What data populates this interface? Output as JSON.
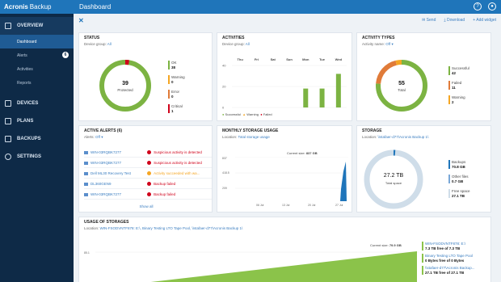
{
  "app": {
    "brand": "Acronis",
    "brand_sub": "Backup",
    "page_title": "Dashboard"
  },
  "sidebar": {
    "sections": [
      {
        "label": "OVERVIEW"
      },
      {
        "label": "DEVICES"
      },
      {
        "label": "PLANS"
      },
      {
        "label": "BACKUPS"
      },
      {
        "label": "SETTINGS"
      }
    ],
    "overview_items": [
      {
        "label": "Dashboard"
      },
      {
        "label": "Alerts",
        "badge": "6"
      },
      {
        "label": "Activities"
      },
      {
        "label": "Reports"
      }
    ]
  },
  "toolbar": {
    "send": "Send",
    "download": "Download",
    "add_widget": "+ Add widget"
  },
  "status": {
    "title": "STATUS",
    "filter_label": "Device group:",
    "filter_value": "All",
    "center_value": "39",
    "center_label": "Protected",
    "legend": [
      {
        "label": "OK",
        "value": "38",
        "color": "#7cb342"
      },
      {
        "label": "Warning",
        "value": "0",
        "color": "#f5a623"
      },
      {
        "label": "Error",
        "value": "0",
        "color": "#e07b39"
      },
      {
        "label": "Critical",
        "value": "1",
        "color": "#d0021b"
      }
    ]
  },
  "activities": {
    "title": "ACTIVITIES",
    "filter_label": "Device group:",
    "filter_value": "All",
    "legend": {
      "success": "Successful",
      "warning": "Warning",
      "failed": "Failed"
    },
    "chart_data": {
      "type": "bar",
      "categories": [
        "Thu",
        "Fri",
        "Sat",
        "Sun",
        "Mon",
        "Tue",
        "Wed"
      ],
      "ylim": [
        0,
        40
      ],
      "yticks": [
        "40",
        "20",
        "0"
      ],
      "series": [
        {
          "name": "Successful",
          "values": [
            0,
            0,
            0,
            0,
            18,
            18,
            32
          ]
        },
        {
          "name": "Failed",
          "values": [
            0,
            0,
            0,
            0,
            0,
            0,
            0
          ]
        }
      ]
    }
  },
  "activity_types": {
    "title": "ACTIVITY TYPES",
    "filter_label": "Activity name:",
    "filter_value": "Off",
    "center_value": "55",
    "center_label": "Total",
    "legend": [
      {
        "label": "Successful",
        "value": "42",
        "color": "#7cb342"
      },
      {
        "label": "Failed",
        "value": "11",
        "color": "#e07b39"
      },
      {
        "label": "Warning",
        "value": "2",
        "color": "#f5a623"
      }
    ]
  },
  "active_alerts": {
    "title": "ACTIVE ALERTS (6)",
    "filter_label": "Alerts:",
    "filter_value": "Off",
    "show_all": "Show all",
    "rows": [
      {
        "machine": "WIN-03RQBK7277",
        "message": "Suspicious activity is detected",
        "type": "error"
      },
      {
        "machine": "WIN-03RQBK7277",
        "message": "Suspicious activity is detected",
        "type": "error"
      },
      {
        "machine": "Dell ML30 Recovery Test",
        "message": "Activity succeeded with wa...",
        "type": "warning"
      },
      {
        "machine": "DL360GEN9",
        "message": "Backup failed",
        "type": "error"
      },
      {
        "machine": "WIN-03RQBK7277",
        "message": "Backup failed",
        "type": "error"
      }
    ]
  },
  "monthly_storage": {
    "title": "MONTHLY STORAGE USAGE",
    "filter_label": "Location:",
    "filter_value": "Total storage usage",
    "current_label": "Current size:",
    "current_value": "837 GB",
    "yticks": [
      "837",
      "418.5",
      "209"
    ],
    "xticks": [
      "06 Jul",
      "13 Jul",
      "20 Jul",
      "27 Jul"
    ]
  },
  "storage": {
    "title": "STORAGE",
    "filter_label": "Location:",
    "filter_value": "\\\\stafaer-d77\\Acronis Backup 1\\",
    "center_value": "27.2 TB",
    "center_label": "Total space",
    "legend": [
      {
        "label": "Backups",
        "value": "70.8 GB",
        "color": "#1f75ba"
      },
      {
        "label": "Other files",
        "value": "0.7 GB",
        "color": "#7aa8d8"
      },
      {
        "label": "Free space",
        "value": "27.1 TB",
        "color": "#cfdde9"
      }
    ]
  },
  "usage_of_storages": {
    "title": "USAGE OF STORAGES",
    "filter_label": "Location:",
    "filter_value": "WIN-FSODVNTF878: E:\\, Binary Testing LTO Tape Pool, \\\\stafaer-d77\\Acronis Backup 1\\",
    "current_label": "Current size:",
    "current_value": "79.9 GB",
    "ytick": "85.1",
    "legend": [
      {
        "label": "WIN-FSODVNTF878: E:\\",
        "value": "7.3 TB free of 7.3 TB"
      },
      {
        "label": "Binary Testing LTO Tape Pool",
        "value": "0 Bytes free of 0 Bytes"
      },
      {
        "label": "\\\\stafaer-d77\\Acronis Backup...",
        "value": "27.1 TB free of 27.1 TB"
      }
    ]
  }
}
